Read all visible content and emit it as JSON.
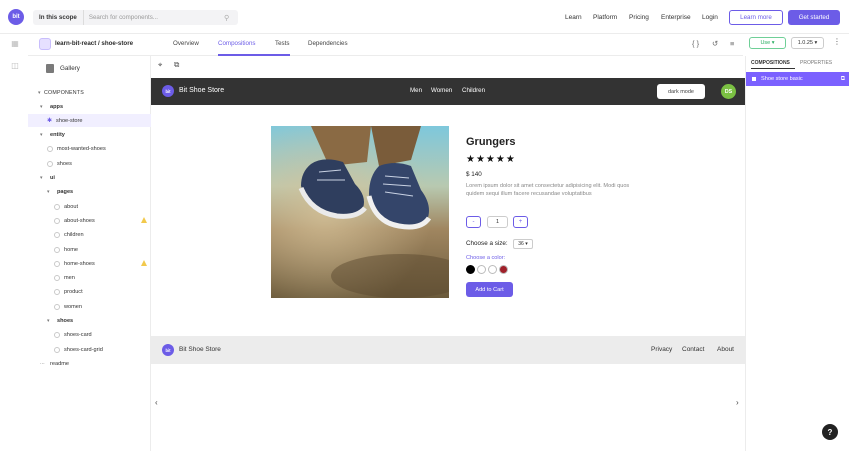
{
  "topbar": {
    "logo_text": "bit",
    "scope_label": "In this scope",
    "search_placeholder": "Search for components...",
    "nav": [
      "Learn",
      "Platform",
      "Pricing",
      "Enterprise",
      "Login"
    ],
    "learn_more": "Learn more",
    "get_started": "Get started"
  },
  "component": {
    "path": "learn-bit-react / shoe-store",
    "tabs": [
      "Overview",
      "Compositions",
      "Tests",
      "Dependencies"
    ],
    "active_tab": "Compositions",
    "use_label": "Use",
    "version": "1.0.25"
  },
  "sidebar": {
    "gallery": "Gallery",
    "section": "COMPONENTS",
    "tree": [
      {
        "label": "apps",
        "type": "folder",
        "level": 0
      },
      {
        "label": "shoe-store",
        "type": "item",
        "level": 1,
        "selected": true
      },
      {
        "label": "entity",
        "type": "folder",
        "level": 0
      },
      {
        "label": "most-wanted-shoes",
        "type": "item",
        "level": 1
      },
      {
        "label": "shoes",
        "type": "item",
        "level": 1
      },
      {
        "label": "ui",
        "type": "folder",
        "level": 0
      },
      {
        "label": "pages",
        "type": "folder",
        "level": 1
      },
      {
        "label": "about",
        "type": "item",
        "level": 2
      },
      {
        "label": "about-shoes",
        "type": "item",
        "level": 2,
        "warning": true
      },
      {
        "label": "children",
        "type": "item",
        "level": 2
      },
      {
        "label": "home",
        "type": "item",
        "level": 2
      },
      {
        "label": "home-shoes",
        "type": "item",
        "level": 2,
        "warning": true
      },
      {
        "label": "men",
        "type": "item",
        "level": 2
      },
      {
        "label": "product",
        "type": "item",
        "level": 2
      },
      {
        "label": "women",
        "type": "item",
        "level": 2
      },
      {
        "label": "shoes",
        "type": "folder",
        "level": 1
      },
      {
        "label": "shoes-card",
        "type": "item",
        "level": 2
      },
      {
        "label": "shoes-card-grid",
        "type": "item",
        "level": 2
      },
      {
        "label": "readme",
        "type": "readme",
        "level": 0
      }
    ]
  },
  "preview": {
    "header": {
      "logo_text": "bit",
      "brand": "Bit Shoe Store",
      "nav": [
        "Men",
        "Women",
        "Children"
      ],
      "dark_mode": "dark mode",
      "avatar": "DS"
    },
    "product": {
      "title": "Grungers",
      "stars": "★★★★★",
      "rating": 5,
      "price": "$ 140",
      "description": "Lorem ipsum dolor sit amet consectetur adipisicing elit. Modi quos quidem sequi illum facere recusandae voluptatibus",
      "minus": "-",
      "quantity": "1",
      "plus": "+",
      "size_label": "Choose a size:",
      "size_value": "36",
      "color_label": "Choose a color:",
      "colors": [
        "#000000",
        "#ffffff",
        "#ffffff",
        "#a0202a"
      ],
      "add_to_cart": "Add to Cart"
    },
    "footer": {
      "logo_text": "bit",
      "brand": "Bit Shoe Store",
      "links": [
        "Privacy",
        "Contact",
        "About"
      ]
    }
  },
  "rpanel": {
    "tabs": [
      "COMPOSITIONS",
      "PROPERTIES"
    ],
    "selected": "Shoe store basic"
  },
  "help": "?"
}
